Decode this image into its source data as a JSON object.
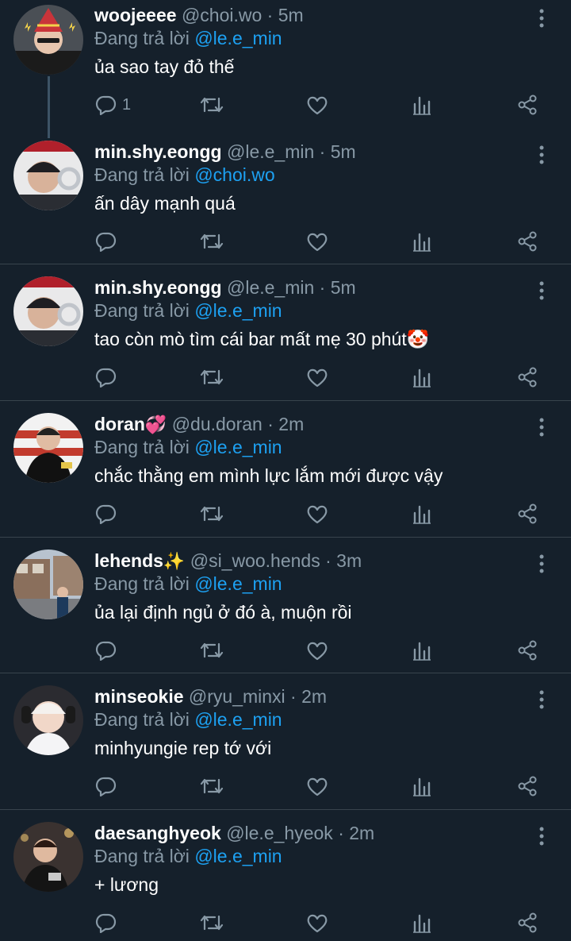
{
  "tweets": [
    {
      "name": "woojeeee",
      "emoji": "",
      "handle": "@choi.wo",
      "dot": "·",
      "time": "5m",
      "replying_prefix": "Đang trả lời",
      "replying_to": "@le.e_min",
      "text": "ủa sao tay đỏ thế",
      "reply_count": "1"
    },
    {
      "name": "min.shy.eongg",
      "emoji": "",
      "handle": "@le.e_min",
      "dot": "·",
      "time": "5m",
      "replying_prefix": "Đang trả lời",
      "replying_to": "@choi.wo",
      "text": "ấn dây mạnh quá",
      "reply_count": ""
    },
    {
      "name": "min.shy.eongg",
      "emoji": "",
      "handle": "@le.e_min",
      "dot": "·",
      "time": "5m",
      "replying_prefix": "Đang trả lời",
      "replying_to": "@le.e_min",
      "text": "tao còn mò tìm cái bar mất mẹ 30 phút🤡",
      "reply_count": ""
    },
    {
      "name": "doran",
      "emoji": "💞",
      "handle": "@du.doran",
      "dot": "·",
      "time": "2m",
      "replying_prefix": "Đang trả lời",
      "replying_to": "@le.e_min",
      "text": "chắc thằng em mình lực lắm mới được vậy",
      "reply_count": ""
    },
    {
      "name": "lehends",
      "emoji": "✨",
      "handle": "@si_woo.hends",
      "dot": "·",
      "time": "3m",
      "replying_prefix": "Đang trả lời",
      "replying_to": "@le.e_min",
      "text": "ủa lại định ngủ ở đó à, muộn rồi",
      "reply_count": ""
    },
    {
      "name": "minseokie",
      "emoji": "",
      "handle": "@ryu_minxi",
      "dot": "·",
      "time": "2m",
      "replying_prefix": "Đang trả lời",
      "replying_to": "@le.e_min",
      "text": "minhyungie rep tớ với",
      "reply_count": ""
    },
    {
      "name": "daesanghyeok",
      "emoji": "",
      "handle": "@le.e_hyeok",
      "dot": "·",
      "time": "2m",
      "replying_prefix": "Đang trả lời",
      "replying_to": "@le.e_min",
      "text": "+ lương",
      "reply_count": ""
    }
  ],
  "icons": [
    "reply-icon",
    "retweet-icon",
    "like-icon",
    "analytics-icon",
    "share-icon",
    "more-options-icon"
  ],
  "colors": {
    "background": "#15202b",
    "divider": "#38444d",
    "secondary_text": "#8899a6",
    "mention": "#1da1f2",
    "primary_text": "#ffffff"
  }
}
